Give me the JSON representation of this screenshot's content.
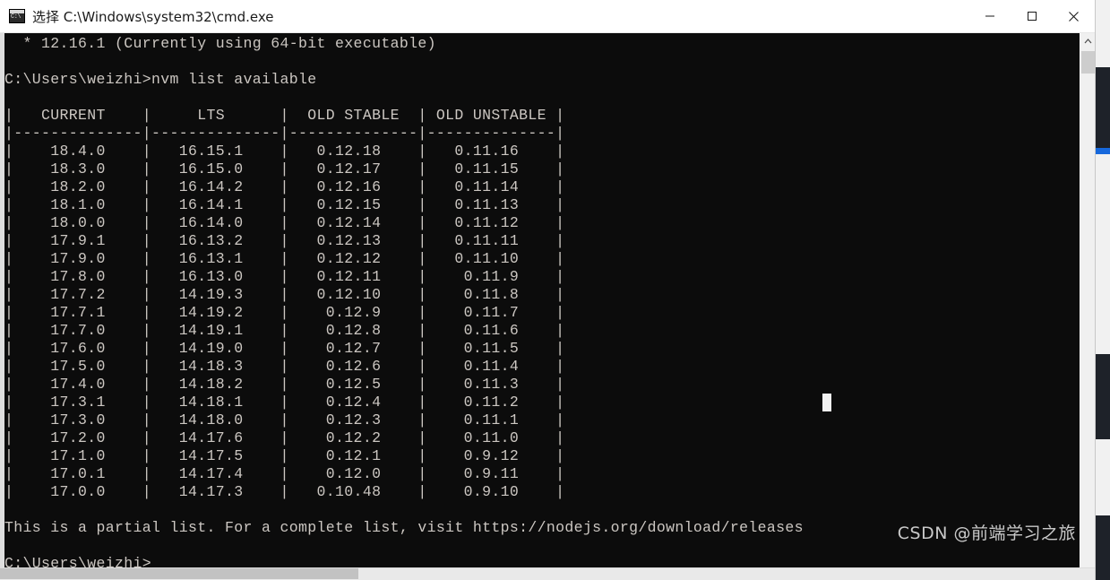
{
  "window": {
    "title": "选择 C:\\Windows\\system32\\cmd.exe",
    "icon": "cmd-console-icon",
    "controls": {
      "minimize": "minimize-button",
      "maximize": "maximize-button",
      "close": "close-button"
    }
  },
  "theme": {
    "console_bg": "#0c0c0c",
    "console_fg": "#ccc7c2",
    "titlebar_bg": "#ffffff",
    "titlebar_fg": "#1a1a1a",
    "cursor": "#f2f2f2",
    "accent": "#1668dc"
  },
  "console": {
    "line_current_version": "  * 12.16.1 (Currently using 64-bit executable)",
    "blank_1": "",
    "prompt_command": "C:\\Users\\weizhi>nvm list available",
    "blank_2": "",
    "table": {
      "border_top": "|   CURRENT    |     LTS      |  OLD STABLE  | OLD UNSTABLE |",
      "border_rule": " --------------|--------------|--------------|--------------|",
      "headers": [
        "CURRENT",
        "LTS",
        "OLD STABLE",
        "OLD UNSTABLE"
      ],
      "rows": [
        [
          "18.4.0",
          "16.15.1",
          "0.12.18",
          "0.11.16"
        ],
        [
          "18.3.0",
          "16.15.0",
          "0.12.17",
          "0.11.15"
        ],
        [
          "18.2.0",
          "16.14.2",
          "0.12.16",
          "0.11.14"
        ],
        [
          "18.1.0",
          "16.14.1",
          "0.12.15",
          "0.11.13"
        ],
        [
          "18.0.0",
          "16.14.0",
          "0.12.14",
          "0.11.12"
        ],
        [
          "17.9.1",
          "16.13.2",
          "0.12.13",
          "0.11.11"
        ],
        [
          "17.9.0",
          "16.13.1",
          "0.12.12",
          "0.11.10"
        ],
        [
          "17.8.0",
          "16.13.0",
          "0.12.11",
          "0.11.9"
        ],
        [
          "17.7.2",
          "14.19.3",
          "0.12.10",
          "0.11.8"
        ],
        [
          "17.7.1",
          "14.19.2",
          "0.12.9",
          "0.11.7"
        ],
        [
          "17.7.0",
          "14.19.1",
          "0.12.8",
          "0.11.6"
        ],
        [
          "17.6.0",
          "14.19.0",
          "0.12.7",
          "0.11.5"
        ],
        [
          "17.5.0",
          "14.18.3",
          "0.12.6",
          "0.11.4"
        ],
        [
          "17.4.0",
          "14.18.2",
          "0.12.5",
          "0.11.3"
        ],
        [
          "17.3.1",
          "14.18.1",
          "0.12.4",
          "0.11.2"
        ],
        [
          "17.3.0",
          "14.18.0",
          "0.12.3",
          "0.11.1"
        ],
        [
          "17.2.0",
          "14.17.6",
          "0.12.2",
          "0.11.0"
        ],
        [
          "17.1.0",
          "14.17.5",
          "0.12.1",
          "0.9.12"
        ],
        [
          "17.0.1",
          "14.17.4",
          "0.12.0",
          "0.9.11"
        ],
        [
          "17.0.0",
          "14.17.3",
          "0.10.48",
          "0.9.10"
        ]
      ]
    },
    "footer_note": "This is a partial list. For a complete list, visit https://nodejs.org/download/releases",
    "blank_3": "",
    "prompt_trailing": "C:\\Users\\weizhi>",
    "rendered_text": "  * 12.16.1 (Currently using 64-bit executable)\n\nC:\\Users\\weizhi>nvm list available\n\n|   CURRENT    |     LTS      |  OLD STABLE  | OLD UNSTABLE |\n|--------------|--------------|--------------|--------------|\n|    18.4.0    |   16.15.1    |   0.12.18    |   0.11.16    |\n|    18.3.0    |   16.15.0    |   0.12.17    |   0.11.15    |\n|    18.2.0    |   16.14.2    |   0.12.16    |   0.11.14    |\n|    18.1.0    |   16.14.1    |   0.12.15    |   0.11.13    |\n|    18.0.0    |   16.14.0    |   0.12.14    |   0.11.12    |\n|    17.9.1    |   16.13.2    |   0.12.13    |   0.11.11    |\n|    17.9.0    |   16.13.1    |   0.12.12    |   0.11.10    |\n|    17.8.0    |   16.13.0    |   0.12.11    |    0.11.9    |\n|    17.7.2    |   14.19.3    |   0.12.10    |    0.11.8    |\n|    17.7.1    |   14.19.2    |    0.12.9    |    0.11.7    |\n|    17.7.0    |   14.19.1    |    0.12.8    |    0.11.6    |\n|    17.6.0    |   14.19.0    |    0.12.7    |    0.11.5    |\n|    17.5.0    |   14.18.3    |    0.12.6    |    0.11.4    |\n|    17.4.0    |   14.18.2    |    0.12.5    |    0.11.3    |\n|    17.3.1    |   14.18.1    |    0.12.4    |    0.11.2    |\n|    17.3.0    |   14.18.0    |    0.12.3    |    0.11.1    |\n|    17.2.0    |   14.17.6    |    0.12.2    |    0.11.0    |\n|    17.1.0    |   14.17.5    |    0.12.1    |    0.9.12    |\n|    17.0.1    |   14.17.4    |    0.12.0    |    0.9.11    |\n|    17.0.0    |   14.17.3    |   0.10.48    |    0.9.10    |\n\nThis is a partial list. For a complete list, visit https://nodejs.org/download/releases\n\nC:\\Users\\weizhi>"
  },
  "watermark": {
    "text": "CSDN @前端学习之旅"
  },
  "scrollbars": {
    "vertical": {
      "up_arrow": "scroll-up-arrow",
      "thumb": "vertical-scroll-thumb"
    },
    "horizontal": {
      "thumb": "horizontal-scroll-thumb"
    }
  }
}
